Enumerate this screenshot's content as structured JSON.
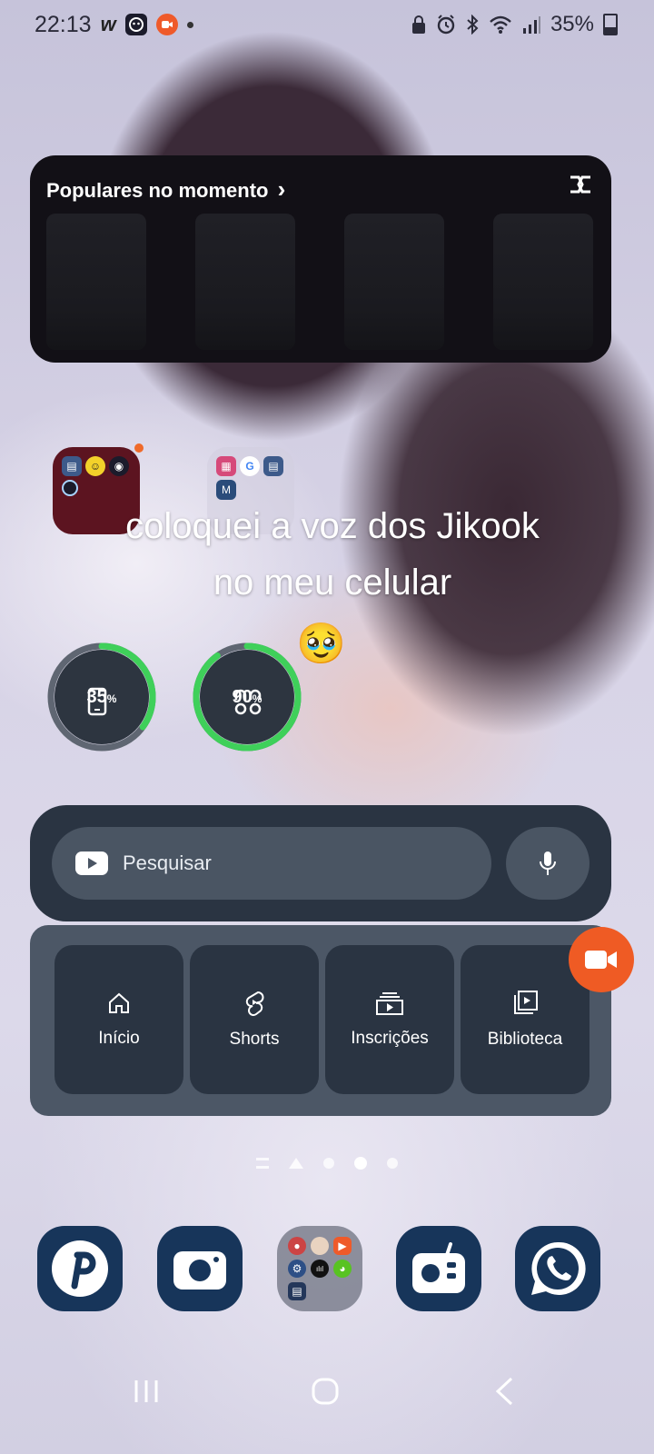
{
  "status_bar": {
    "time": "22:13",
    "battery": "35%",
    "notif_icons": [
      "w-app-icon",
      "face-app-icon",
      "camera-recorder-icon",
      "dot-icon"
    ],
    "system_icons": [
      "lock-icon",
      "alarm-icon",
      "bluetooth-icon",
      "wifi-icon",
      "signal-icon",
      "battery-icon"
    ]
  },
  "capcut_widget": {
    "title": "Populares no momento",
    "chevron": "›",
    "logo": "capcut-logo-icon"
  },
  "caption": {
    "line1": "coloquei a voz dos Jikook",
    "line2": "no meu celular",
    "emoji": "🥹"
  },
  "battery_widgets": [
    {
      "icon": "phone-icon",
      "value": "35",
      "unit": "%",
      "level": 0.35,
      "color": "#3fd05a"
    },
    {
      "icon": "earbuds-icon",
      "value": "90",
      "unit": "%",
      "level": 0.9,
      "color": "#3fd05a"
    }
  ],
  "youtube_widget": {
    "search_placeholder": "Pesquisar",
    "tabs": [
      {
        "label": "Início",
        "icon": "home-icon"
      },
      {
        "label": "Shorts",
        "icon": "shorts-icon"
      },
      {
        "label": "Inscrições",
        "icon": "subscriptions-icon"
      },
      {
        "label": "Biblioteca",
        "icon": "library-icon"
      }
    ]
  },
  "pages": {
    "count": 4,
    "active": 2
  },
  "dock": [
    "pinterest-icon",
    "camera-icon",
    "apps-folder",
    "radio-icon",
    "whatsapp-icon"
  ],
  "colors": {
    "accent_orange": "#ef5b24",
    "ring_green": "#3fd05a",
    "youtube_panel": "#2a3442",
    "dock_icon_bg": "#17355a"
  }
}
